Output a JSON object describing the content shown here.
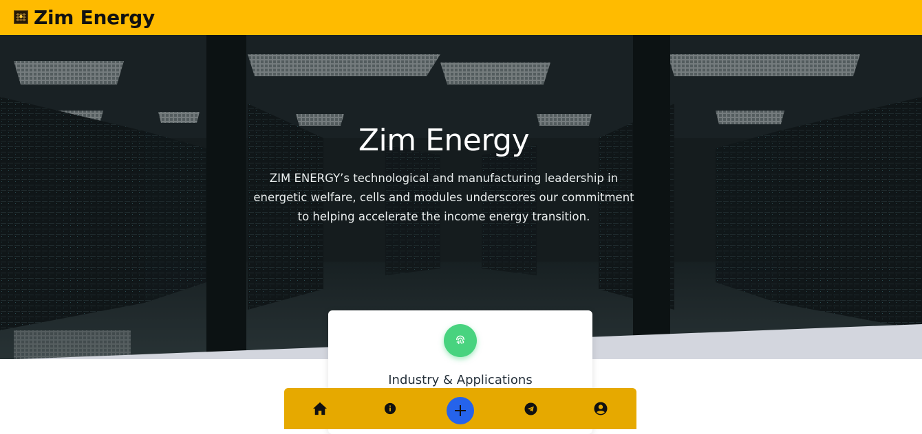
{
  "header": {
    "brand": "Zim Energy",
    "logo_icon": "solar-panel-logo-icon",
    "background_color": "#ffbb00"
  },
  "hero": {
    "title": "Zim Energy",
    "description": "ZIM ENERGY’s technological and manufacturing leadership in energetic welfare, cells and modules underscores our commitment to helping accelerate the income energy transition.",
    "background_icon": "server-room-image"
  },
  "card": {
    "icon": "fingerprint-icon",
    "icon_color": "#48d37f",
    "title": "Industry & Applications"
  },
  "bottom_nav": {
    "background_color": "#e6a900",
    "items": [
      {
        "icon": "home-icon"
      },
      {
        "icon": "info-icon"
      },
      {
        "icon": "plus-icon",
        "color": "#2563eb"
      },
      {
        "icon": "telegram-icon"
      },
      {
        "icon": "user-circle-icon"
      }
    ]
  }
}
